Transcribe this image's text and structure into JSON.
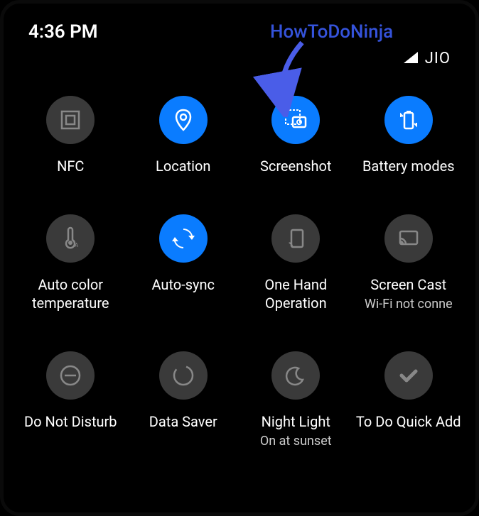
{
  "status": {
    "time": "4:36 PM",
    "carrier": "JIO"
  },
  "watermark": "HowToDoNinja",
  "tiles": [
    {
      "label": "NFC",
      "secondary": "",
      "active": false,
      "icon": "nfc"
    },
    {
      "label": "Location",
      "secondary": "",
      "active": true,
      "icon": "location"
    },
    {
      "label": "Screenshot",
      "secondary": "",
      "active": true,
      "icon": "screenshot"
    },
    {
      "label": "Battery modes",
      "secondary": "",
      "active": true,
      "icon": "battery"
    },
    {
      "label": "Auto color temperature",
      "secondary": "",
      "active": false,
      "icon": "thermometer"
    },
    {
      "label": "Auto-sync",
      "secondary": "",
      "active": true,
      "icon": "sync"
    },
    {
      "label": "One Hand Operation",
      "secondary": "",
      "active": false,
      "icon": "onehand"
    },
    {
      "label": "Screen Cast",
      "secondary": "Wi-Fi not conne",
      "active": false,
      "icon": "cast"
    },
    {
      "label": "Do Not Disturb",
      "secondary": "",
      "active": false,
      "icon": "dnd"
    },
    {
      "label": "Data Saver",
      "secondary": "",
      "active": false,
      "icon": "datasaver"
    },
    {
      "label": "Night Light",
      "secondary": "On at sunset",
      "active": false,
      "icon": "moon"
    },
    {
      "label": "To Do Quick Add",
      "secondary": "",
      "active": false,
      "icon": "todo"
    }
  ]
}
